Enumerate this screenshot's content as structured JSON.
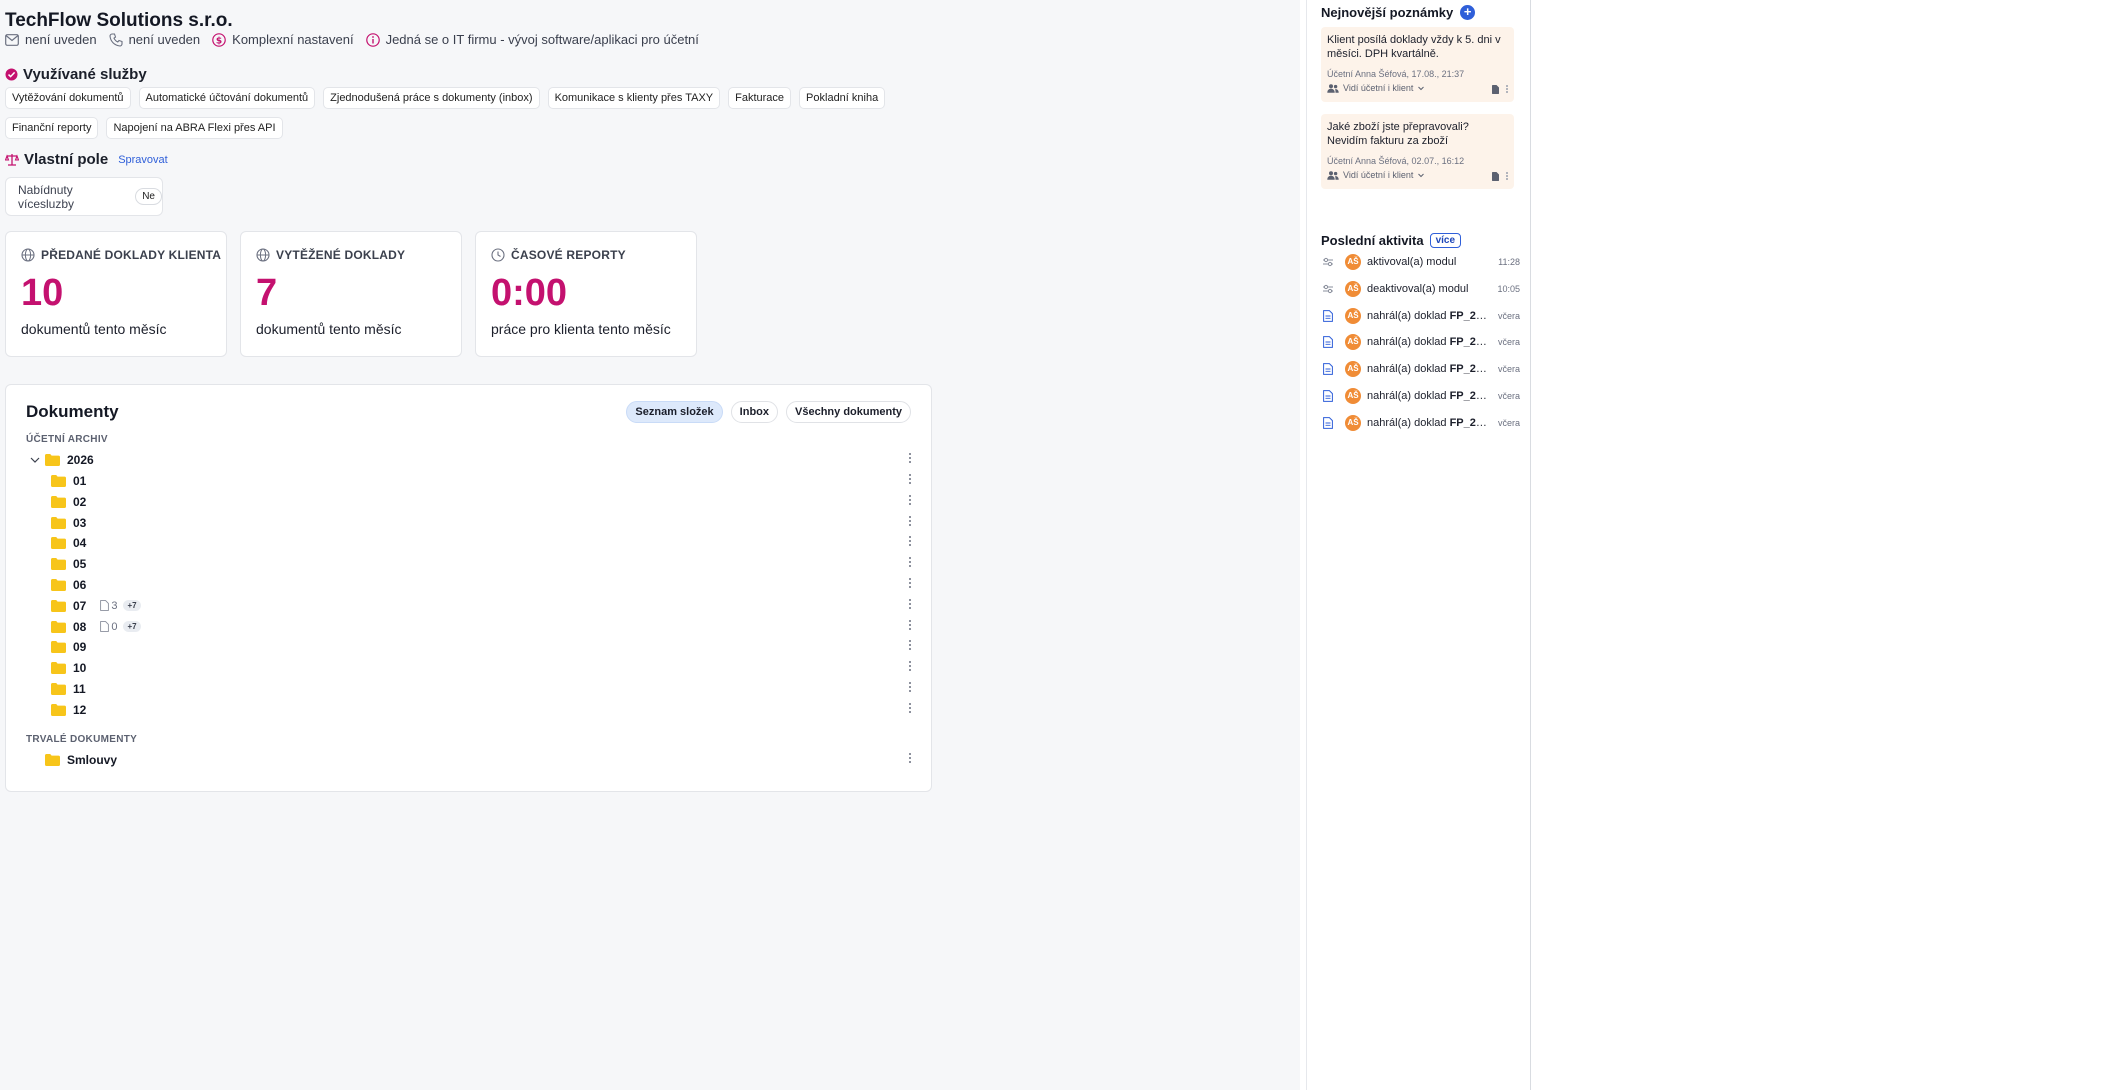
{
  "header": {
    "company_name": "TechFlow Solutions s.r.o.",
    "email": "není uveden",
    "phone": "není uveden",
    "settings": "Komplexní nastavení",
    "info": "Jedná se o IT firmu - vývoj software/aplikaci pro účetní"
  },
  "services": {
    "title": "Využívané služby",
    "items": [
      "Vytěžování dokumentů",
      "Automatické účtování dokumentů",
      "Zjednodušená práce s dokumenty (inbox)",
      "Komunikace s klienty přes TAXY",
      "Fakturace",
      "Pokladní kniha",
      "Finanční reporty",
      "Napojení na ABRA Flexi přes API"
    ]
  },
  "custom_fields": {
    "title": "Vlastní pole",
    "manage": "Spravovat",
    "field_label": "Nabídnuty vícesluzby",
    "field_value": "Ne"
  },
  "stats": [
    {
      "label": "PŘEDANÉ DOKLADY KLIENTA",
      "value": "10",
      "sub": "dokumentů tento měsíc",
      "icon": "globe-icon"
    },
    {
      "label": "VYTĚŽENÉ DOKLADY",
      "value": "7",
      "sub": "dokumentů tento měsíc",
      "icon": "globe-icon"
    },
    {
      "label": "ČASOVÉ REPORTY",
      "value": "0:00",
      "sub": "práce pro klienta tento měsíc",
      "icon": "clock-icon"
    }
  ],
  "documents": {
    "title": "Dokumenty",
    "tabs": [
      "Seznam složek",
      "Inbox",
      "Všechny dokumenty"
    ],
    "active_tab": "Seznam složek",
    "archive_label": "ÚČETNÍ ARCHIV",
    "year": "2026",
    "months": [
      {
        "name": "01"
      },
      {
        "name": "02"
      },
      {
        "name": "03"
      },
      {
        "name": "04"
      },
      {
        "name": "05"
      },
      {
        "name": "06"
      },
      {
        "name": "07",
        "count": "3",
        "badge": "+7"
      },
      {
        "name": "08",
        "count": "0",
        "badge": "+7"
      },
      {
        "name": "09"
      },
      {
        "name": "10"
      },
      {
        "name": "11"
      },
      {
        "name": "12"
      }
    ],
    "permanent_label": "TRVALÉ DOKUMENTY",
    "permanent_folder": "Smlouvy"
  },
  "notes": {
    "title": "Nejnovější poznámky",
    "items": [
      {
        "text": "Klient posílá doklady vždy k 5. dni v měsíci. DPH kvartálně.",
        "meta": "Účetní Anna Šéfová, 17.08., 21:37",
        "visibility": "Vidí účetní i klient"
      },
      {
        "text": "Jaké zboží jste přepravovali? Nevidím fakturu za zboží",
        "meta": "Účetní Anna Šéfová, 02.07., 16:12",
        "visibility": "Vidí účetní i klient"
      }
    ]
  },
  "activity": {
    "title": "Poslední aktivita",
    "more": "více",
    "avatar": "AŠ",
    "items": [
      {
        "icon": "toggle-icon",
        "action": "aktivoval(a) modul",
        "target": "",
        "time": "11:28"
      },
      {
        "icon": "toggle-icon",
        "action": "deaktivoval(a) modul",
        "target": "",
        "time": "10:05"
      },
      {
        "icon": "document-icon",
        "action": "nahrál(a) doklad ",
        "target": "FP_20...",
        "time": "včera"
      },
      {
        "icon": "document-icon",
        "action": "nahrál(a) doklad ",
        "target": "FP_20...",
        "time": "včera"
      },
      {
        "icon": "document-icon",
        "action": "nahrál(a) doklad ",
        "target": "FP_20...",
        "time": "včera"
      },
      {
        "icon": "document-icon",
        "action": "nahrál(a) doklad ",
        "target": "FP_20...",
        "time": "včera"
      },
      {
        "icon": "document-icon",
        "action": "nahrál(a) doklad ",
        "target": "FP_20...",
        "time": "včera"
      }
    ]
  },
  "colors": {
    "accent": "#c4116f",
    "link": "#2f5fd9",
    "folder": "#f7c51a",
    "note_bg": "#fdf3ea",
    "avatar": "#f08c36"
  }
}
